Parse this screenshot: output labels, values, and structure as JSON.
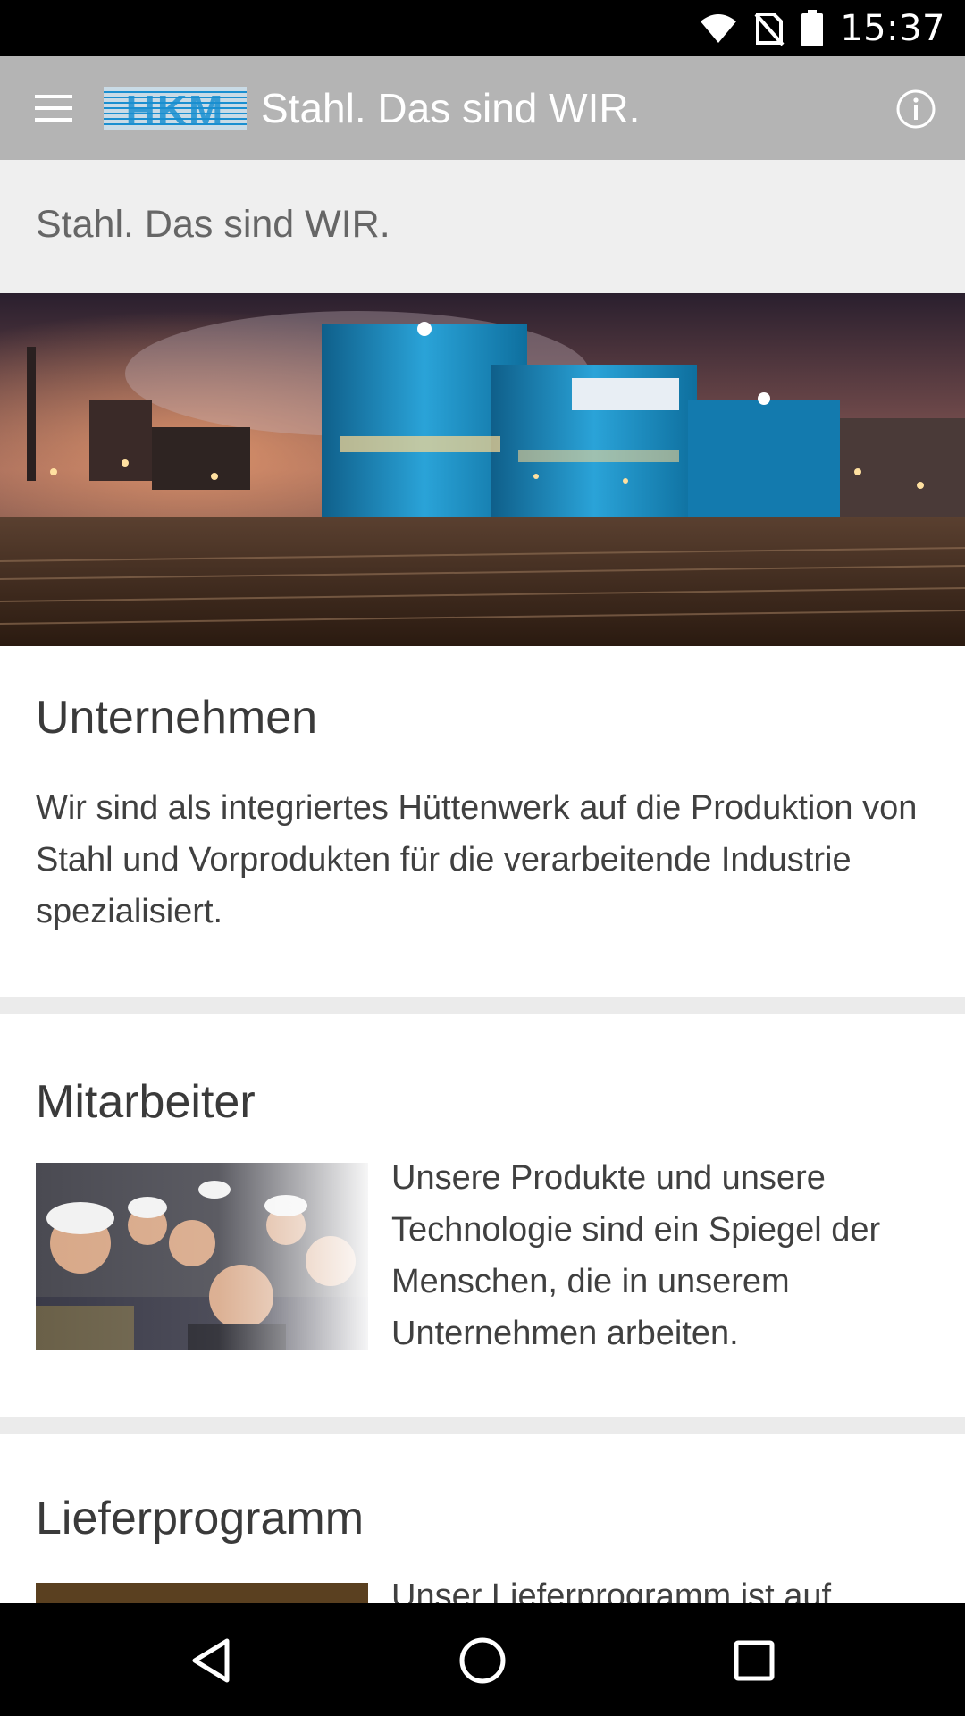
{
  "status_bar": {
    "time": "15:37",
    "icons": [
      "wifi-icon",
      "no-sim-icon",
      "battery-icon"
    ]
  },
  "app_bar": {
    "logo_text": "HKM",
    "title": "Stahl. Das sind WIR.",
    "icons": [
      "menu-icon",
      "info-icon"
    ]
  },
  "page": {
    "heading": "Stahl. Das sind WIR."
  },
  "sections": {
    "unternehmen": {
      "title": "Unternehmen",
      "text": "Wir sind als integriertes Hüttenwerk auf die Produktion von Stahl und Vorprodukten für die verarbeitende Industrie spezialisiert."
    },
    "mitarbeiter": {
      "title": "Mitarbeiter",
      "text": "Unsere Produkte und unsere Technologie sind ein Spiegel der Menschen, die in unserem Unternehmen arbeiten."
    },
    "lieferprogramm": {
      "title": "Lieferprogramm",
      "text": "Unser Lieferprogramm ist auf"
    }
  },
  "nav_bar": {
    "icons": [
      "back-icon",
      "home-icon",
      "recents-icon"
    ]
  },
  "colors": {
    "app_bar": "#b4b4b4",
    "header_bg": "#efefef",
    "logo_blue": "#1a8fd0",
    "divider": "#ebebeb"
  }
}
